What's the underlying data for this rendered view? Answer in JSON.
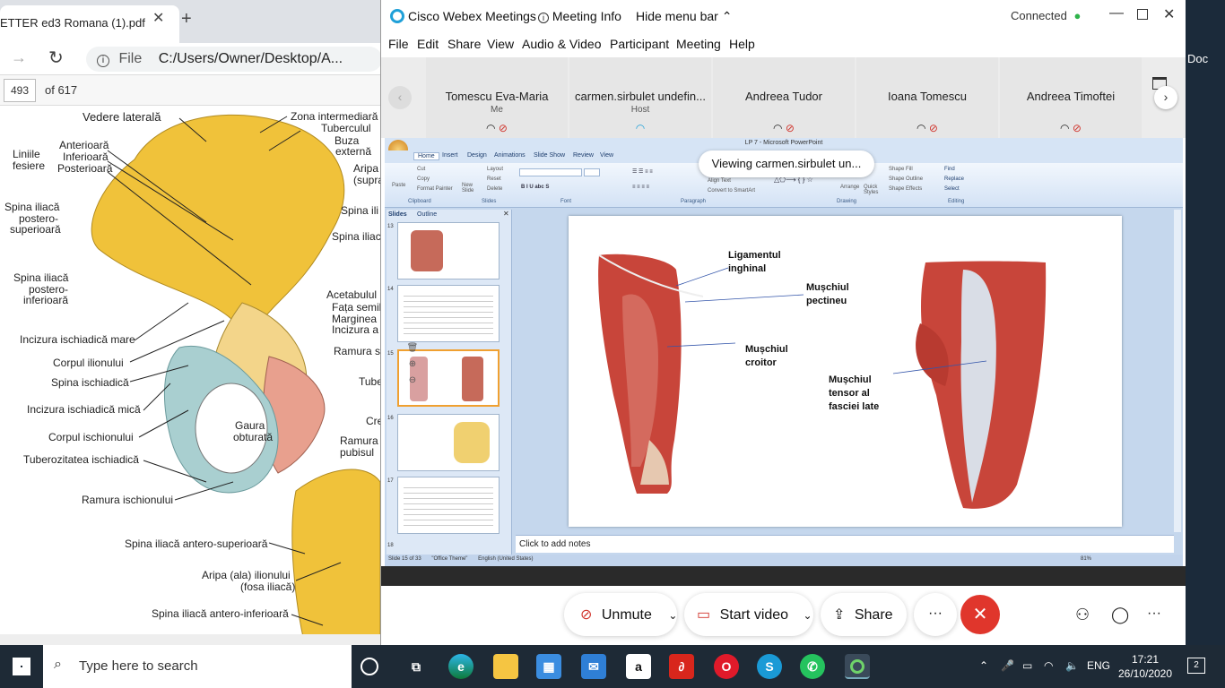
{
  "pdf": {
    "tab_title": "ETTER ed3 Romana (1).pdf",
    "url_label": "File",
    "url": "C:/Users/Owner/Desktop/A...",
    "page_current": "493",
    "page_of": "of 617",
    "labels": {
      "vedere_laterala": "Vedere laterală",
      "zona_intermediara": "Zona intermediară",
      "tuberculul": "Tuberculul",
      "buza_externa_1": "Buza",
      "buza_externa_2": "externă",
      "aripa": "Aripa",
      "supra": "(supra",
      "liniile": "Liniile",
      "fesiere": "fesiere",
      "anterioara": "Anterioară",
      "inferioara": "Inferioară",
      "posterioara": "Posterioară",
      "spina_ps_1": "Spina iliacă",
      "spina_ps_2": "postero-",
      "spina_ps_3": "superioară",
      "spina_ili": "Spina ili",
      "spina_iliac": "Spina iliac",
      "spina_pi_1": "Spina iliacă",
      "spina_pi_2": "postero-",
      "spina_pi_3": "inferioară",
      "acetabulul": "Acetabulul",
      "fata_semil": "Fața semil",
      "marginea": "Marginea",
      "incizura_a": "Incizura a",
      "incizura_mare": "Incizura ischiadică mare",
      "ramura_s": "Ramura s",
      "corpul_ilionului": "Corpul ilionului",
      "spina_ischiadica": "Spina ischiadică",
      "tube": "Tube",
      "incizura_mica": "Incizura ischiadică mică",
      "cre": "Cre",
      "gaura_1": "Gaura",
      "gaura_2": "obturată",
      "corpul_ischionului": "Corpul ischionului",
      "ramura_pub_1": "Ramura",
      "ramura_pub_2": "pubisul",
      "tuberozitatea": "Tuberozitatea ischiadică",
      "ramura_ischionului": "Ramura ischionului",
      "spina_as": "Spina iliacă antero-superioară",
      "aripa_ilionului_1": "Aripa (ala) ilionului",
      "aripa_ilionului_2": "(fosa iliacă)",
      "spina_ai": "Spina iliacă antero-inferioară"
    }
  },
  "webex": {
    "app_title": "Cisco Webex Meetings",
    "meeting_info": "Meeting Info",
    "hide_menu": "Hide menu bar",
    "status": "Connected",
    "menu": [
      "File",
      "Edit",
      "Share",
      "View",
      "Audio & Video",
      "Participant",
      "Meeting",
      "Help"
    ],
    "participants": [
      {
        "name": "Tomescu Eva-Maria",
        "role": "Me"
      },
      {
        "name": "carmen.sirbulet undefin...",
        "role": "Host"
      },
      {
        "name": "Andreea Tudor",
        "role": ""
      },
      {
        "name": "Ioana Tomescu",
        "role": ""
      },
      {
        "name": "Andreea Timoftei",
        "role": ""
      }
    ],
    "viewing_tip": "Viewing carmen.sirbulet un...",
    "controls": {
      "unmute": "Unmute",
      "start_video": "Start video",
      "share": "Share",
      "more": "···"
    },
    "right_strip_label": "Doc"
  },
  "ppt": {
    "window_title": "LP 7 - Microsoft PowerPoint",
    "tabs": [
      "Home",
      "Insert",
      "Design",
      "Animations",
      "Slide Show",
      "Review",
      "View"
    ],
    "groups": [
      "Clipboard",
      "Slides",
      "Font",
      "Paragraph",
      "Drawing",
      "Editing"
    ],
    "clipboard_items": [
      "Cut",
      "Copy",
      "Format Painter"
    ],
    "paste": "Paste",
    "slides_items": [
      "Layout",
      "Reset",
      "Delete"
    ],
    "new_slide": "New Slide",
    "editing_items": [
      "Find",
      "Replace",
      "Select"
    ],
    "drawing_items": [
      "Shape Fill",
      "Shape Outline",
      "Shape Effects"
    ],
    "arrange": "Arrange",
    "quick_styles": "Quick Styles",
    "align_text": "Align Text",
    "convert_smartart": "Convert to SmartArt",
    "pane_tabs": [
      "Slides",
      "Outline"
    ],
    "thumb_numbers": [
      "13",
      "14",
      "15",
      "16",
      "17",
      "18"
    ],
    "slide_labels": {
      "ligamentul_1": "Ligamentul",
      "ligamentul_2": "inghinal",
      "pectineu_1": "Mușchiul",
      "pectineu_2": "pectineu",
      "croitor_1": "Mușchiul",
      "croitor_2": "croitor",
      "tensor_1": "Mușchiul",
      "tensor_2": "tensor al",
      "tensor_3": "fasciei late"
    },
    "notes_placeholder": "Click to add notes",
    "status_slide": "Slide 15 of 33",
    "status_theme": "\"Office Theme\"",
    "status_lang": "English (United States)",
    "zoom": "81%"
  },
  "taskbar": {
    "search_placeholder": "Type here to search",
    "language": "ENG",
    "time": "17:21",
    "date": "26/10/2020",
    "notifications": "2"
  }
}
